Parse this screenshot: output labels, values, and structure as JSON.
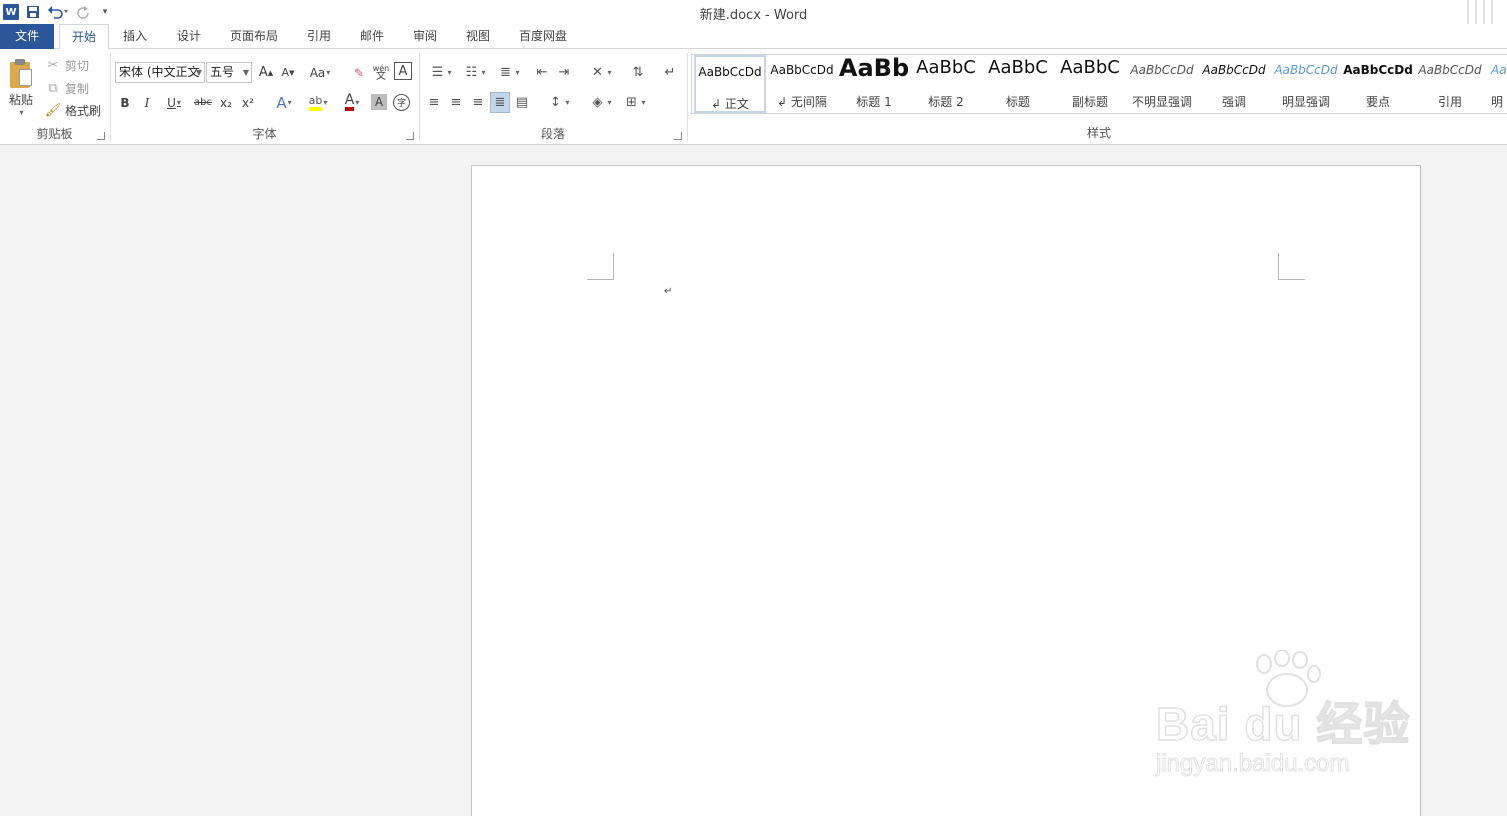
{
  "titlebar": {
    "title": "新建.docx - Word"
  },
  "tabs": [
    {
      "label": "文件"
    },
    {
      "label": "开始"
    },
    {
      "label": "插入"
    },
    {
      "label": "设计"
    },
    {
      "label": "页面布局"
    },
    {
      "label": "引用"
    },
    {
      "label": "邮件"
    },
    {
      "label": "审阅"
    },
    {
      "label": "视图"
    },
    {
      "label": "百度网盘"
    }
  ],
  "clipboard": {
    "paste": "粘贴",
    "cut": "剪切",
    "copy": "复制",
    "format_painter": "格式刷",
    "group": "剪贴板"
  },
  "font": {
    "name": "宋体 (中文正文",
    "size": "五号",
    "group": "字体",
    "case_label": "Aa",
    "bold": "B",
    "italic": "I",
    "underline": "U",
    "strike": "abc",
    "sub": "x₂",
    "sup": "x²",
    "grow": "A",
    "shrink": "A",
    "phonetic": "wén",
    "border_char": "A",
    "enclose": "字",
    "effect": "A",
    "font_color": "A",
    "shade": "A"
  },
  "paragraph": {
    "group": "段落"
  },
  "styles": {
    "group": "样式",
    "items": [
      {
        "preview": "AaBbCcDd",
        "name": "正文"
      },
      {
        "preview": "AaBbCcDd",
        "name": "无间隔"
      },
      {
        "preview": "AaBb",
        "name": "标题 1"
      },
      {
        "preview": "AaBbC",
        "name": "标题 2"
      },
      {
        "preview": "AaBbC",
        "name": "标题"
      },
      {
        "preview": "AaBbC",
        "name": "副标题"
      },
      {
        "preview": "AaBbCcDd",
        "name": "不明显强调"
      },
      {
        "preview": "AaBbCcDd",
        "name": "强调"
      },
      {
        "preview": "AaBbCcDd",
        "name": "明显强调"
      },
      {
        "preview": "AaBbCcDd",
        "name": "要点"
      },
      {
        "preview": "AaBbCcDd",
        "name": "引用"
      },
      {
        "preview": "Aa",
        "name": "明"
      }
    ]
  },
  "document": {
    "paragraph_mark": "↵"
  },
  "watermark": {
    "brand": "Bai du 经验",
    "url": "jingyan.baidu.com"
  },
  "colors": {
    "accent": "#2b579a",
    "highlight": "#ffff00",
    "font_color": "#c00000"
  }
}
